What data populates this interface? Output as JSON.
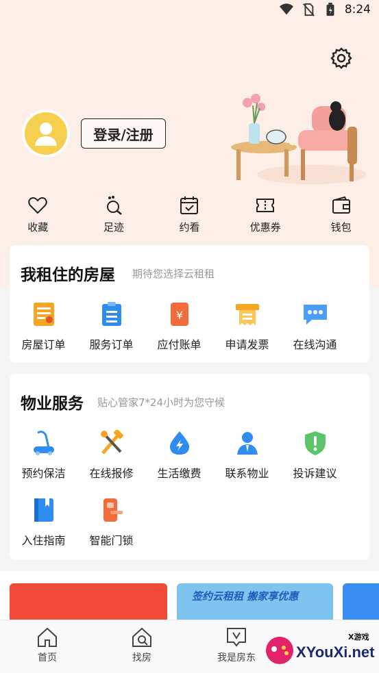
{
  "status_bar": {
    "time": "8:24"
  },
  "profile": {
    "login_label": "登录/注册"
  },
  "quick_actions": [
    {
      "label": "收藏",
      "icon": "heart-icon"
    },
    {
      "label": "足迹",
      "icon": "footprint-icon"
    },
    {
      "label": "约看",
      "icon": "calendar-icon"
    },
    {
      "label": "优惠券",
      "icon": "coupon-icon"
    },
    {
      "label": "钱包",
      "icon": "wallet-icon"
    }
  ],
  "rental": {
    "title": "我租住的房屋",
    "subtitle": "期待您选择云租租",
    "items": [
      {
        "label": "房屋订单",
        "icon": "house-order-icon",
        "color": "#f5a623"
      },
      {
        "label": "服务订单",
        "icon": "service-order-icon",
        "color": "#2f8df0"
      },
      {
        "label": "应付账单",
        "icon": "payable-bill-icon",
        "color": "#f26b3a"
      },
      {
        "label": "申请发票",
        "icon": "invoice-icon",
        "color": "#f5a623"
      },
      {
        "label": "在线沟通",
        "icon": "chat-icon",
        "color": "#4a9ef5"
      }
    ]
  },
  "property": {
    "title": "物业服务",
    "subtitle": "贴心管家7*24小时为您守候",
    "items": [
      {
        "label": "预约保洁",
        "icon": "vacuum-icon",
        "color": "#2f8df0"
      },
      {
        "label": "在线报修",
        "icon": "repair-tools-icon",
        "color": "#f5a623"
      },
      {
        "label": "生活缴费",
        "icon": "water-drop-icon",
        "color": "#2f8df0"
      },
      {
        "label": "联系物业",
        "icon": "manager-icon",
        "color": "#2f8df0"
      },
      {
        "label": "投诉建议",
        "icon": "shield-alert-icon",
        "color": "#5cc46a"
      },
      {
        "label": "入住指南",
        "icon": "guide-book-icon",
        "color": "#2f8df0"
      },
      {
        "label": "智能门锁",
        "icon": "smart-lock-icon",
        "color": "#f26b3a"
      }
    ]
  },
  "banners": [
    {
      "label": "",
      "color": "#f24a3a"
    },
    {
      "label": "签约云租租  搬家享优惠",
      "color": "#7fc3f0"
    },
    {
      "label": "",
      "color": "#3a8df0"
    }
  ],
  "tabs": [
    {
      "label": "首页",
      "icon": "home-icon"
    },
    {
      "label": "找房",
      "icon": "find-house-icon"
    },
    {
      "label": "我是房东",
      "icon": "landlord-icon"
    }
  ],
  "watermark": {
    "text": "XYouXi.net",
    "top_text": "X游戏"
  }
}
